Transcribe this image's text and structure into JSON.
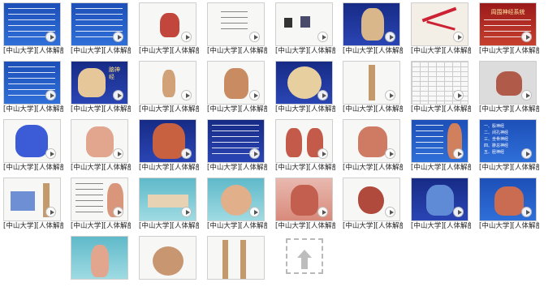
{
  "grid": {
    "caption_prefix": "[中山大学][人体解剖...",
    "rows": [
      [
        "[中山大学][人体解剖...",
        "[中山大学][人体解剖...",
        "[中山大学][人体解剖...",
        "[中山大学][人体解剖...",
        "[中山大学][人体解剖...",
        "[中山大学][人体解剖...",
        "[中山大学][人体解剖...",
        "[中山大学][人体解剖..."
      ],
      [
        "[中山大学][人体解剖...",
        "[中山大学][人体解剖...",
        "[中山大学][人体解剖...",
        "[中山大学][人体解剖...",
        "[中山大学][人体解剖...",
        "[中山大学][人体解剖...",
        "[中山大学][人体解剖...",
        "[中山大学][人体解剖..."
      ],
      [
        "[中山大学][人体解剖...",
        "[中山大学][人体解剖...",
        "[中山大学][人体解剖...",
        "[中山大学][人体解剖...",
        "[中山大学][人体解剖...",
        "[中山大学][人体解剖...",
        "[中山大学][人体解剖...",
        "[中山大学][人体解剖..."
      ],
      [
        "[中山大学][人体解剖...",
        "[中山大学][人体解剖...",
        "[中山大学][人体解剖...",
        "[中山大学][人体解剖...",
        "[中山大学][人体解剖...",
        "[中山大学][人体解剖...",
        "[中山大学][人体解剖...",
        "[中山大学][人体解剖..."
      ]
    ],
    "last_row": [
      "",
      "",
      ""
    ]
  },
  "slides": {
    "r1c8_title": "周围神经系统",
    "r2c2_title": "脑神经",
    "r3c8_list": [
      "一、股神经",
      "二、闭孔神经",
      "三、坐骨神经",
      "四、腓总神经",
      "五、胫神经"
    ]
  },
  "colors": {
    "accent": "#1d4fb8",
    "caption": "#222222"
  },
  "upload": {
    "icon": "upload-arrow-icon"
  }
}
